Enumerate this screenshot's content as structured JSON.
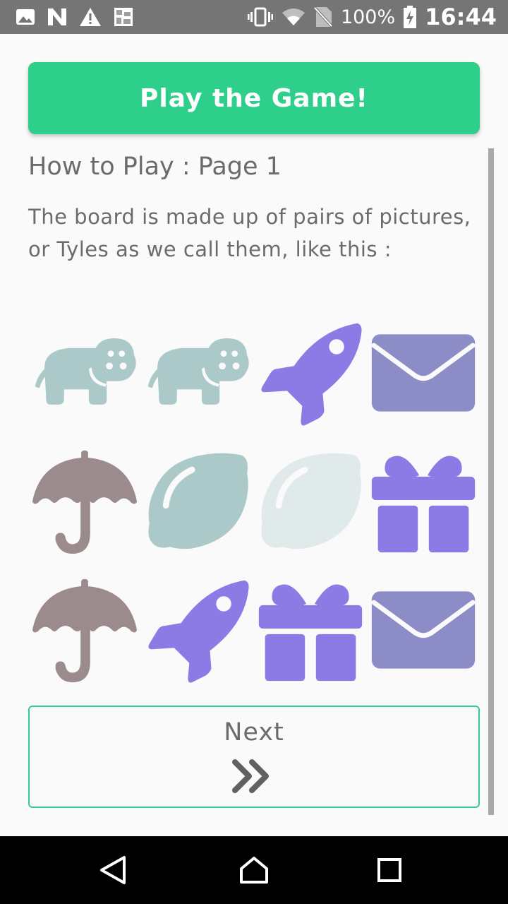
{
  "status_bar": {
    "battery_percent": "100%",
    "time": "16:44"
  },
  "play_button": {
    "label": "Play the Game!"
  },
  "how_to": {
    "heading": "How to Play : Page 1",
    "description": "The board is made up of pairs of pictures, or Tyles as we call them, like this :"
  },
  "board": {
    "rows": [
      [
        "hippo",
        "hippo",
        "rocket",
        "envelope"
      ],
      [
        "umbrella",
        "lemon",
        "lemon-faded",
        "gift"
      ],
      [
        "umbrella",
        "rocket",
        "gift",
        "envelope"
      ]
    ]
  },
  "colors": {
    "accent": "#2ecf8a",
    "hippo": "#acc9c9",
    "lemon": "#acc9c9",
    "lemon_faded": "#e0eaeb",
    "rocket": "#8c7be4",
    "gift": "#8c7be4",
    "envelope": "#8c8cc6",
    "umbrella": "#9b8b8d"
  },
  "next_button": {
    "label": "Next",
    "icon": "double-chevron-right-icon"
  },
  "nav_bar": {
    "back": "back-icon",
    "home": "home-icon",
    "recents": "recents-icon"
  }
}
